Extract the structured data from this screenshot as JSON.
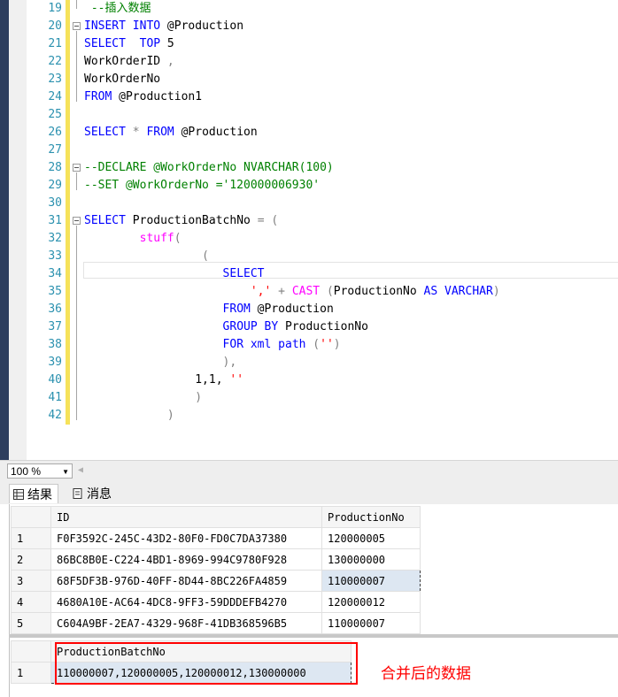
{
  "editor": {
    "lines": [
      {
        "n": "19",
        "parts": [
          {
            "t": " --插入数据",
            "c": "cm"
          }
        ]
      },
      {
        "n": "20",
        "fold": true,
        "parts": [
          {
            "t": "INSERT",
            "c": "kw"
          },
          {
            "t": " ",
            "c": "tx"
          },
          {
            "t": "INTO",
            "c": "kw"
          },
          {
            "t": " @Production",
            "c": "tx"
          }
        ]
      },
      {
        "n": "21",
        "parts": [
          {
            "t": "SELECT",
            "c": "kw"
          },
          {
            "t": "  ",
            "c": "tx"
          },
          {
            "t": "TOP",
            "c": "kw"
          },
          {
            "t": " 5",
            "c": "tx"
          }
        ]
      },
      {
        "n": "22",
        "parts": [
          {
            "t": "WorkOrderID ",
            "c": "tx"
          },
          {
            "t": ",",
            "c": "gy"
          }
        ]
      },
      {
        "n": "23",
        "parts": [
          {
            "t": "WorkOrderNo",
            "c": "tx"
          }
        ]
      },
      {
        "n": "24",
        "parts": [
          {
            "t": "FROM",
            "c": "kw"
          },
          {
            "t": " @Production1",
            "c": "tx"
          }
        ]
      },
      {
        "n": "25",
        "parts": []
      },
      {
        "n": "26",
        "parts": [
          {
            "t": "SELECT",
            "c": "kw"
          },
          {
            "t": " ",
            "c": "tx"
          },
          {
            "t": "*",
            "c": "gy"
          },
          {
            "t": " ",
            "c": "tx"
          },
          {
            "t": "FROM",
            "c": "kw"
          },
          {
            "t": " @Production",
            "c": "tx"
          }
        ]
      },
      {
        "n": "27",
        "parts": []
      },
      {
        "n": "28",
        "fold": true,
        "parts": [
          {
            "t": "--DECLARE @WorkOrderNo NVARCHAR(100)",
            "c": "cm"
          }
        ]
      },
      {
        "n": "29",
        "parts": [
          {
            "t": "--SET @WorkOrderNo ='120000006930'",
            "c": "cm"
          }
        ]
      },
      {
        "n": "30",
        "parts": []
      },
      {
        "n": "31",
        "fold": true,
        "parts": [
          {
            "t": "SELECT",
            "c": "kw"
          },
          {
            "t": " ProductionBatchNo ",
            "c": "tx"
          },
          {
            "t": "= (",
            "c": "gy"
          }
        ]
      },
      {
        "n": "32",
        "parts": [
          {
            "t": "        ",
            "c": "tx"
          },
          {
            "t": "stuff",
            "c": "fn"
          },
          {
            "t": "(",
            "c": "gy"
          }
        ]
      },
      {
        "n": "33",
        "parts": [
          {
            "t": "                 ",
            "c": "tx"
          },
          {
            "t": "(",
            "c": "gy"
          }
        ]
      },
      {
        "n": "34",
        "parts": [
          {
            "t": "                    ",
            "c": "tx"
          },
          {
            "t": "SELECT",
            "c": "kw"
          }
        ]
      },
      {
        "n": "35",
        "parts": [
          {
            "t": "                        ",
            "c": "tx"
          },
          {
            "t": "','",
            "c": "str"
          },
          {
            "t": " + ",
            "c": "gy"
          },
          {
            "t": "CAST",
            "c": "fn"
          },
          {
            "t": " (",
            "c": "gy"
          },
          {
            "t": "ProductionNo ",
            "c": "tx"
          },
          {
            "t": "AS",
            "c": "kw"
          },
          {
            "t": " ",
            "c": "tx"
          },
          {
            "t": "VARCHAR",
            "c": "kw"
          },
          {
            "t": ")",
            "c": "gy"
          }
        ]
      },
      {
        "n": "36",
        "parts": [
          {
            "t": "                    ",
            "c": "tx"
          },
          {
            "t": "FROM",
            "c": "kw"
          },
          {
            "t": " @Production",
            "c": "tx"
          }
        ]
      },
      {
        "n": "37",
        "parts": [
          {
            "t": "                    ",
            "c": "tx"
          },
          {
            "t": "GROUP BY",
            "c": "kw"
          },
          {
            "t": " ProductionNo",
            "c": "tx"
          }
        ]
      },
      {
        "n": "38",
        "parts": [
          {
            "t": "                    ",
            "c": "tx"
          },
          {
            "t": "FOR",
            "c": "kw"
          },
          {
            "t": " ",
            "c": "tx"
          },
          {
            "t": "xml",
            "c": "kw"
          },
          {
            "t": " ",
            "c": "tx"
          },
          {
            "t": "path",
            "c": "kw"
          },
          {
            "t": " (",
            "c": "gy"
          },
          {
            "t": "''",
            "c": "str"
          },
          {
            "t": ")",
            "c": "gy"
          }
        ]
      },
      {
        "n": "39",
        "parts": [
          {
            "t": "                    ",
            "c": "tx"
          },
          {
            "t": "),",
            "c": "gy"
          }
        ]
      },
      {
        "n": "40",
        "parts": [
          {
            "t": "                ",
            "c": "tx"
          },
          {
            "t": "1,1,",
            "c": "tx"
          },
          {
            "t": " ",
            "c": "tx"
          },
          {
            "t": "''",
            "c": "str"
          }
        ]
      },
      {
        "n": "41",
        "parts": [
          {
            "t": "                ",
            "c": "tx"
          },
          {
            "t": ")",
            "c": "gy"
          }
        ]
      },
      {
        "n": "42",
        "parts": [
          {
            "t": "            ",
            "c": "tx"
          },
          {
            "t": ")",
            "c": "gy"
          }
        ]
      }
    ]
  },
  "status": {
    "zoom": "100 %"
  },
  "tabs": {
    "results": "结果",
    "messages": "消息"
  },
  "grid1": {
    "columns": [
      "ID",
      "ProductionNo"
    ],
    "rows": [
      [
        "1",
        "F0F3592C-245C-43D2-80F0-FD0C7DA37380",
        "120000005"
      ],
      [
        "2",
        "86BC8B0E-C224-4BD1-8969-994C9780F928",
        "130000000"
      ],
      [
        "3",
        "68F5DF3B-976D-40FF-8D44-8BC226FA4859",
        "110000007"
      ],
      [
        "4",
        "4680A10E-AC64-4DC8-9FF3-59DDDEFB4270",
        "120000012"
      ],
      [
        "5",
        "C604A9BF-2EA7-4329-968F-41DB368596B5",
        "110000007"
      ]
    ]
  },
  "grid2": {
    "columns": [
      "ProductionBatchNo"
    ],
    "rows": [
      [
        "1",
        "110000007,120000005,120000012,130000000"
      ]
    ]
  },
  "annotation": "合并后的数据",
  "colors": {
    "keyword": "#0000ff",
    "comment": "#008000",
    "string": "#ff0000",
    "function": "#ff00ff",
    "highlight": "#ff0000"
  }
}
